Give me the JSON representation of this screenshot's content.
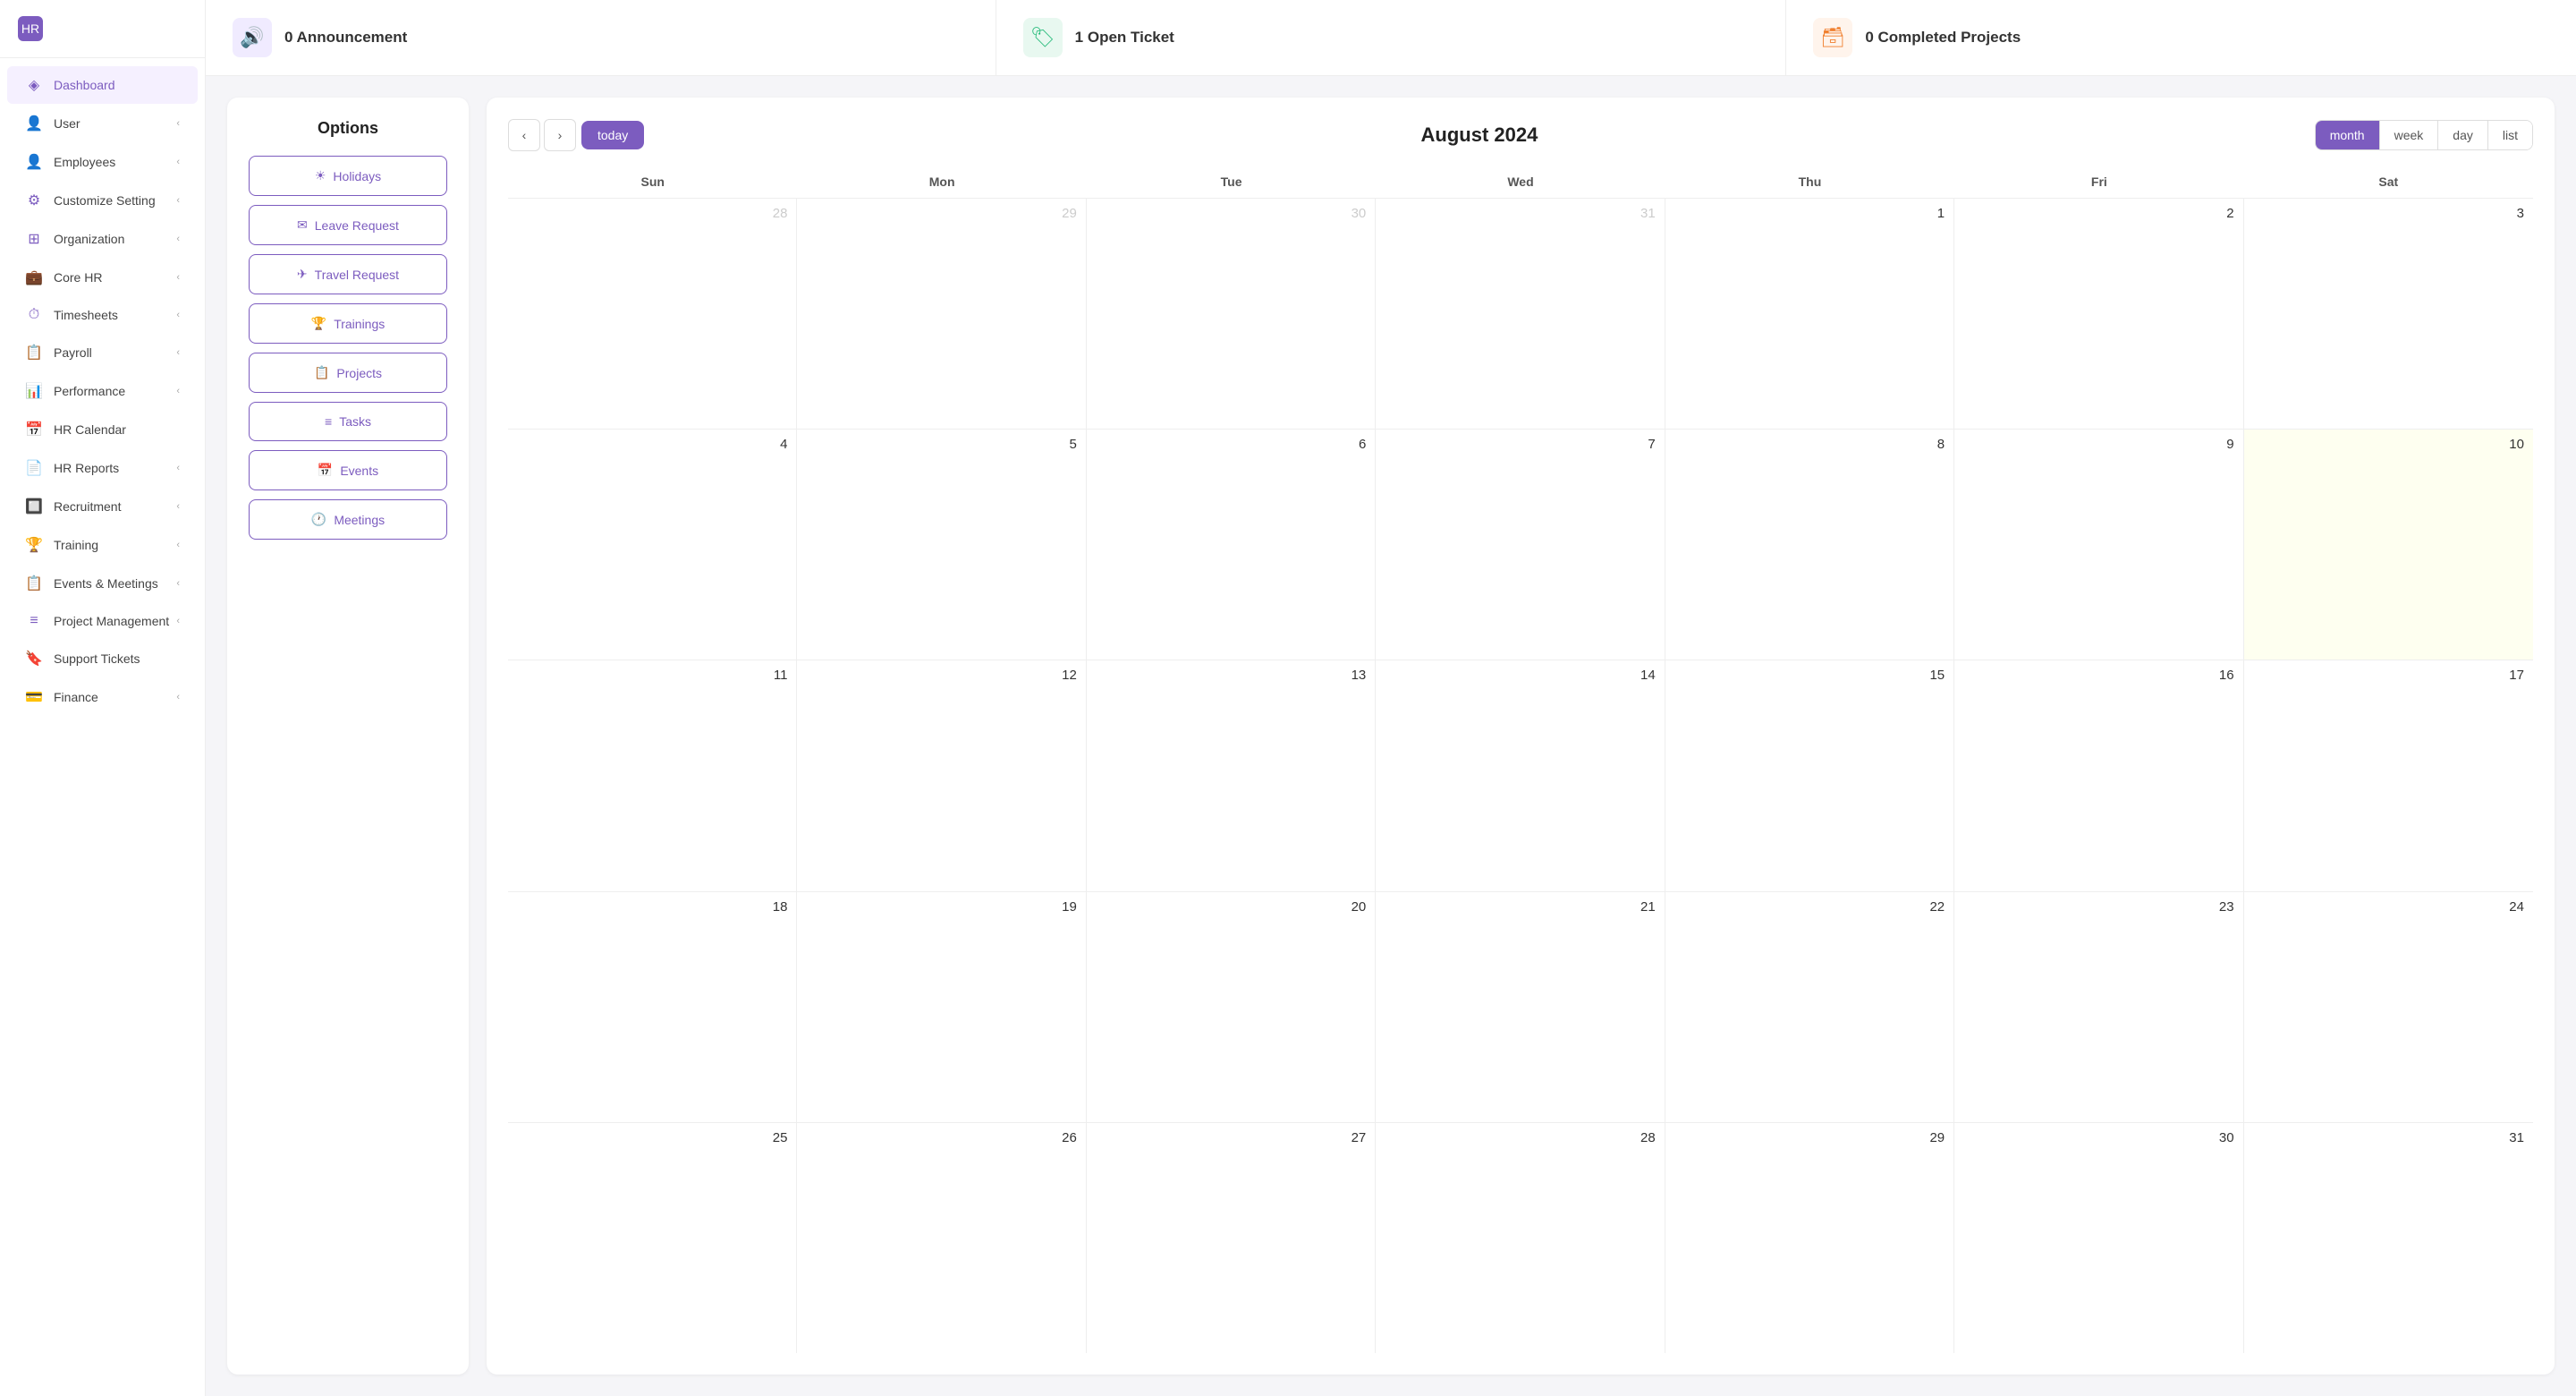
{
  "sidebar": {
    "logo": "HR",
    "items": [
      {
        "id": "dashboard",
        "label": "Dashboard",
        "icon": "◈",
        "hasChevron": false,
        "active": true
      },
      {
        "id": "user",
        "label": "User",
        "icon": "👤",
        "hasChevron": true
      },
      {
        "id": "employees",
        "label": "Employees",
        "icon": "👤",
        "hasChevron": true
      },
      {
        "id": "customize-setting",
        "label": "Customize Setting",
        "icon": "⚙",
        "hasChevron": true
      },
      {
        "id": "organization",
        "label": "Organization",
        "icon": "⊞",
        "hasChevron": true
      },
      {
        "id": "core-hr",
        "label": "Core HR",
        "icon": "💼",
        "hasChevron": true
      },
      {
        "id": "timesheets",
        "label": "Timesheets",
        "icon": "⏱",
        "hasChevron": true
      },
      {
        "id": "payroll",
        "label": "Payroll",
        "icon": "📋",
        "hasChevron": true
      },
      {
        "id": "performance",
        "label": "Performance",
        "icon": "📊",
        "hasChevron": true
      },
      {
        "id": "hr-calendar",
        "label": "HR Calendar",
        "icon": "📅",
        "hasChevron": false
      },
      {
        "id": "hr-reports",
        "label": "HR Reports",
        "icon": "📄",
        "hasChevron": true
      },
      {
        "id": "recruitment",
        "label": "Recruitment",
        "icon": "🔲",
        "hasChevron": true
      },
      {
        "id": "training",
        "label": "Training",
        "icon": "🏆",
        "hasChevron": true
      },
      {
        "id": "events-meetings",
        "label": "Events & Meetings",
        "icon": "📋",
        "hasChevron": true
      },
      {
        "id": "project-management",
        "label": "Project Management",
        "icon": "≡",
        "hasChevron": true
      },
      {
        "id": "support-tickets",
        "label": "Support Tickets",
        "icon": "🔖",
        "hasChevron": false
      },
      {
        "id": "finance",
        "label": "Finance",
        "icon": "💳",
        "hasChevron": true
      }
    ]
  },
  "stats": [
    {
      "id": "announcements",
      "icon": "🔊",
      "colorClass": "purple",
      "label": "0 Announcement"
    },
    {
      "id": "open-tickets",
      "icon": "🏷",
      "colorClass": "green",
      "label": "1 Open Ticket"
    },
    {
      "id": "completed-projects",
      "icon": "🗃",
      "colorClass": "orange",
      "label": "0 Completed Projects"
    }
  ],
  "options": {
    "title": "Options",
    "buttons": [
      {
        "id": "holidays",
        "icon": "☀",
        "label": "Holidays"
      },
      {
        "id": "leave-request",
        "icon": "✉",
        "label": "Leave Request"
      },
      {
        "id": "travel-request",
        "icon": "✈",
        "label": "Travel Request"
      },
      {
        "id": "trainings",
        "icon": "🏆",
        "label": "Trainings"
      },
      {
        "id": "projects",
        "icon": "📋",
        "label": "Projects"
      },
      {
        "id": "tasks",
        "icon": "≡",
        "label": "Tasks"
      },
      {
        "id": "events",
        "icon": "📅",
        "label": "Events"
      },
      {
        "id": "meetings",
        "icon": "🕐",
        "label": "Meetings"
      }
    ]
  },
  "calendar": {
    "title": "August 2024",
    "today_label": "today",
    "view_buttons": [
      "month",
      "week",
      "day",
      "list"
    ],
    "active_view": "month",
    "day_headers": [
      "Sun",
      "Mon",
      "Tue",
      "Wed",
      "Thu",
      "Fri",
      "Sat"
    ],
    "weeks": [
      [
        {
          "date": "28",
          "otherMonth": true
        },
        {
          "date": "29",
          "otherMonth": true
        },
        {
          "date": "30",
          "otherMonth": true
        },
        {
          "date": "31",
          "otherMonth": true
        },
        {
          "date": "1",
          "otherMonth": false
        },
        {
          "date": "2",
          "otherMonth": false
        },
        {
          "date": "3",
          "otherMonth": false
        }
      ],
      [
        {
          "date": "4",
          "otherMonth": false
        },
        {
          "date": "5",
          "otherMonth": false
        },
        {
          "date": "6",
          "otherMonth": false
        },
        {
          "date": "7",
          "otherMonth": false
        },
        {
          "date": "8",
          "otherMonth": false
        },
        {
          "date": "9",
          "otherMonth": false
        },
        {
          "date": "10",
          "otherMonth": false,
          "today": true
        }
      ],
      [
        {
          "date": "11",
          "otherMonth": false
        },
        {
          "date": "12",
          "otherMonth": false
        },
        {
          "date": "13",
          "otherMonth": false
        },
        {
          "date": "14",
          "otherMonth": false
        },
        {
          "date": "15",
          "otherMonth": false
        },
        {
          "date": "16",
          "otherMonth": false
        },
        {
          "date": "17",
          "otherMonth": false
        }
      ],
      [
        {
          "date": "18",
          "otherMonth": false
        },
        {
          "date": "19",
          "otherMonth": false
        },
        {
          "date": "20",
          "otherMonth": false
        },
        {
          "date": "21",
          "otherMonth": false
        },
        {
          "date": "22",
          "otherMonth": false
        },
        {
          "date": "23",
          "otherMonth": false
        },
        {
          "date": "24",
          "otherMonth": false
        }
      ],
      [
        {
          "date": "25",
          "otherMonth": false
        },
        {
          "date": "26",
          "otherMonth": false
        },
        {
          "date": "27",
          "otherMonth": false
        },
        {
          "date": "28",
          "otherMonth": false
        },
        {
          "date": "29",
          "otherMonth": false
        },
        {
          "date": "30",
          "otherMonth": false
        },
        {
          "date": "31",
          "otherMonth": false
        }
      ]
    ]
  }
}
